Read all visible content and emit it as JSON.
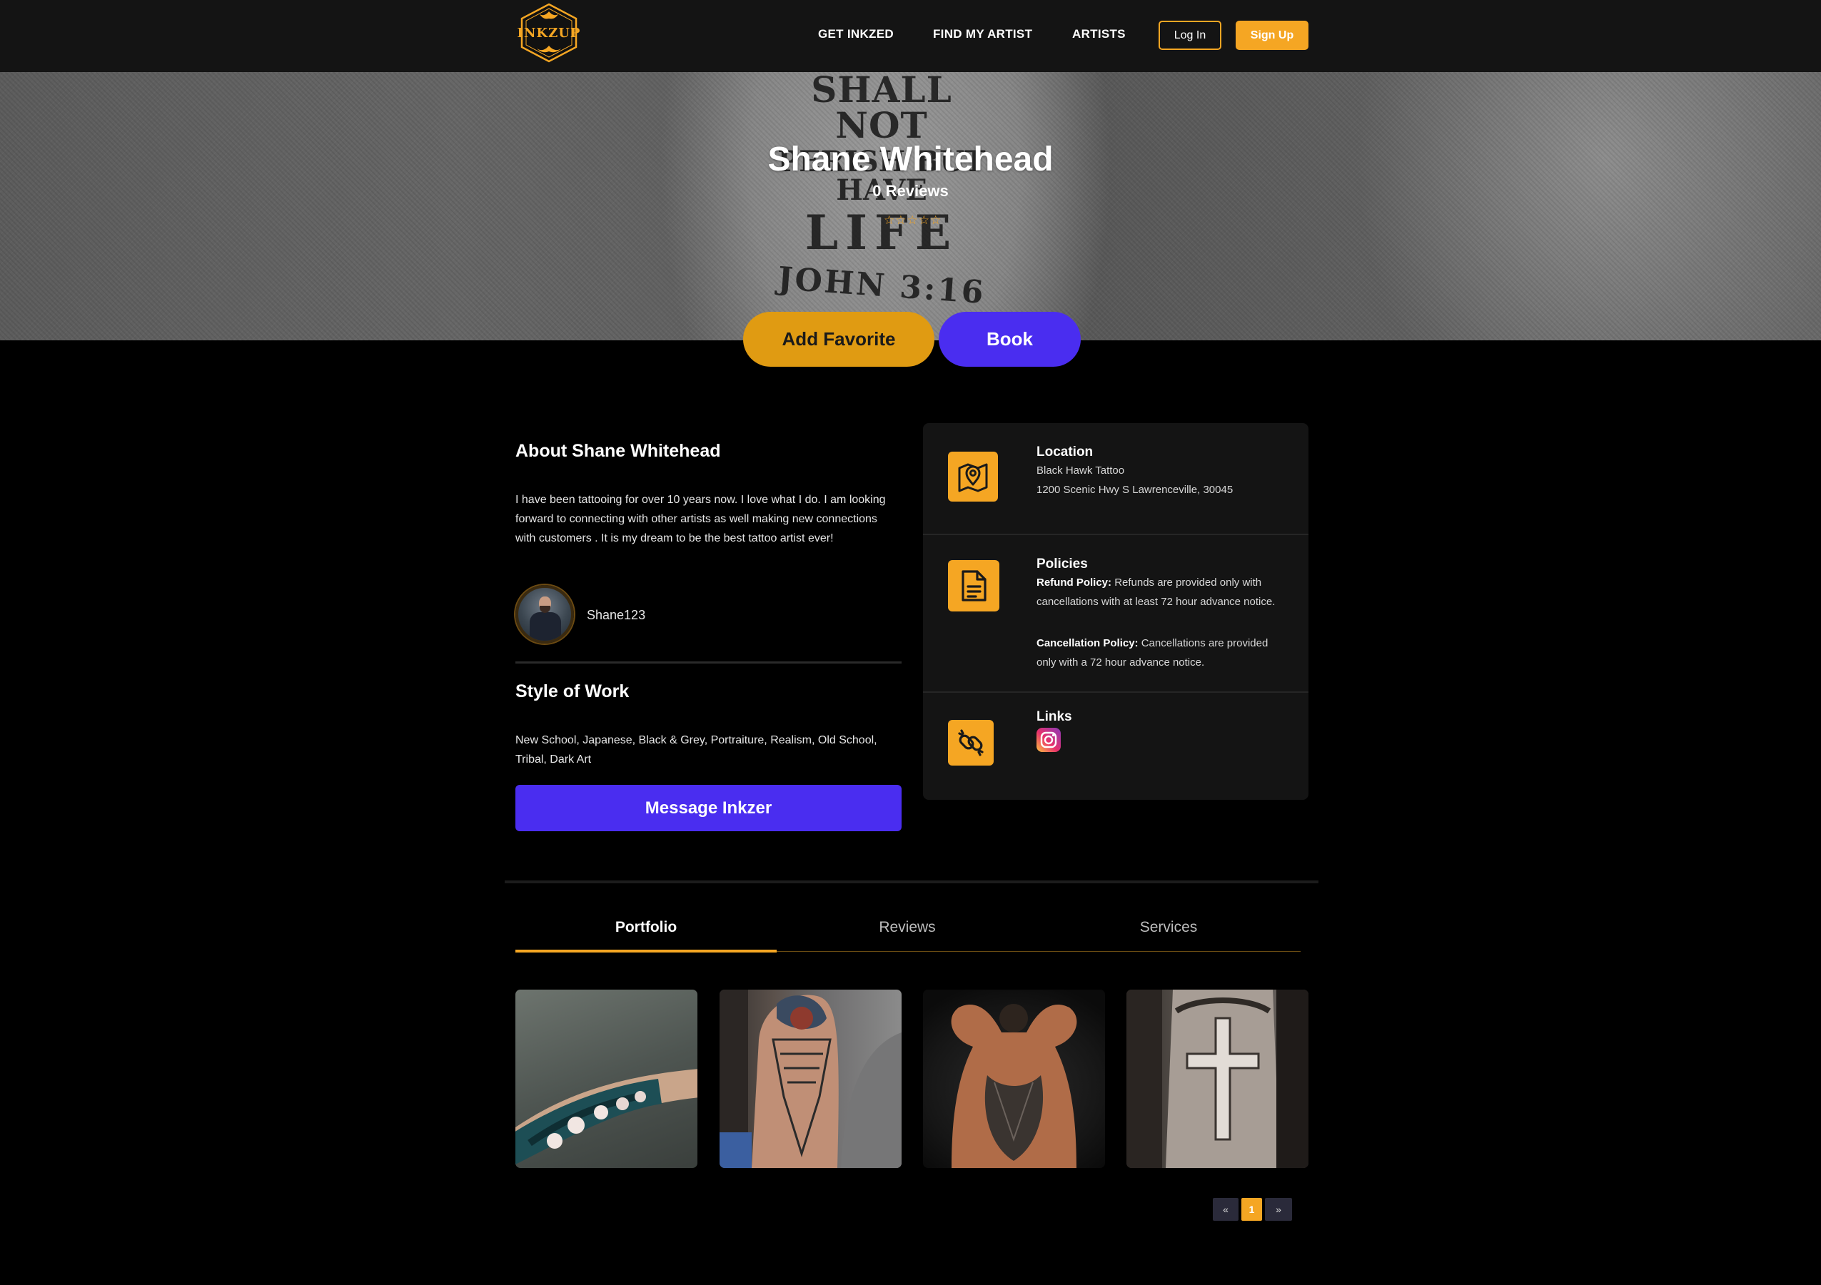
{
  "nav": {
    "logo_text": "INKZUP",
    "links": [
      "GET INKZED",
      "FIND MY ARTIST",
      "ARTISTS"
    ],
    "login_label": "Log In",
    "signup_label": "Sign Up"
  },
  "hero": {
    "tattoo_lines": [
      "SHALL NOT",
      "PERISH BUT HAVE",
      "LIFE",
      "JOHN 3:16"
    ],
    "artist_name": "Shane Whitehead",
    "review_count": "0 Reviews",
    "star_rating": 0,
    "favorite_label": "Add Favorite",
    "book_label": "Book"
  },
  "about": {
    "title": "About Shane Whitehead",
    "text": "I have been tattooing for over 10 years now. I love what I do. I am looking forward to connecting with other artists as well making new connections with customers . It is my dream to be the best tattoo artist ever!",
    "username": "Shane123"
  },
  "style": {
    "title": "Style of Work",
    "text": "New School, Japanese, Black & Grey, Portraiture, Realism, Old School, Tribal, Dark Art",
    "message_label": "Message Inkzer"
  },
  "info": {
    "location": {
      "heading": "Location",
      "shop": "Black Hawk Tattoo",
      "address": "1200 Scenic Hwy S Lawrenceville, 30045"
    },
    "policies": {
      "heading": "Policies",
      "refund_label": "Refund Policy:",
      "refund_text": "Refunds are provided only with cancellations with at least 72 hour advance notice.",
      "cancel_label": "Cancellation Policy:",
      "cancel_text": "Cancellations are provided only with a 72 hour advance notice."
    },
    "links": {
      "heading": "Links",
      "icon": "instagram-icon"
    }
  },
  "tabs": [
    "Portfolio",
    "Reviews",
    "Services"
  ],
  "active_tab": "Portfolio",
  "pagination": {
    "prev": "«",
    "current": "1",
    "next": "»"
  },
  "colors": {
    "accent": "#f5a623",
    "primary": "#4a2df0",
    "background": "#000000",
    "card": "#141414"
  }
}
